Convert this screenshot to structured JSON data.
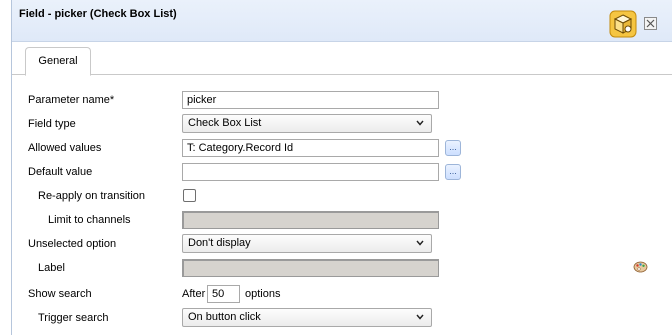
{
  "dialog": {
    "title": "Field - picker (Check Box List)",
    "icons": {
      "app": "package-cube-icon",
      "close": "close-icon"
    }
  },
  "tabs": [
    {
      "label": "General",
      "active": true
    }
  ],
  "form": {
    "parameter_name": {
      "label": "Parameter name*",
      "value": "picker"
    },
    "field_type": {
      "label": "Field type",
      "value": "Check Box List"
    },
    "allowed_values": {
      "label": "Allowed values",
      "value": "T: Category.Record Id",
      "button": "..."
    },
    "default_value": {
      "label": "Default value",
      "value": "",
      "button": "..."
    },
    "reapply_on_transition": {
      "label": "Re-apply on transition",
      "checked": false
    },
    "limit_to_channels": {
      "label": "Limit to channels",
      "value": "",
      "disabled": true
    },
    "unselected_option": {
      "label": "Unselected option",
      "value": "Don't display"
    },
    "label": {
      "label": "Label",
      "value": "",
      "disabled": true,
      "icon": "palette-icon"
    },
    "show_search": {
      "label": "Show search",
      "prefix": "After",
      "value": "50",
      "suffix": "options"
    },
    "trigger_search": {
      "label": "Trigger search",
      "value": "On button click"
    }
  },
  "colors": {
    "titlebar": "#e3ecf9",
    "disabled_field": "#d6d3ce",
    "browse_button": "#cddfff"
  }
}
